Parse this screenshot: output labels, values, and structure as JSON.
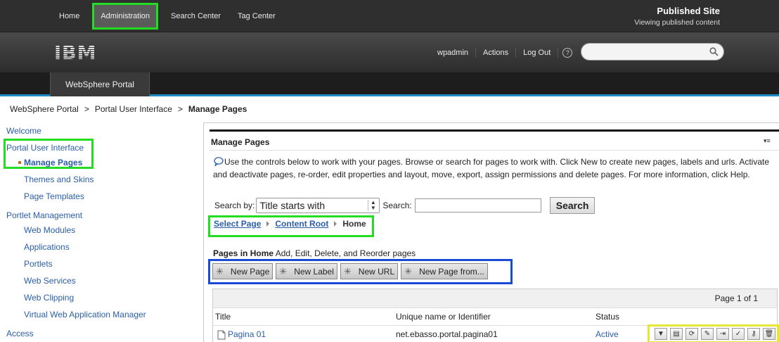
{
  "topnav": {
    "items": [
      "Home",
      "Administration",
      "Search Center",
      "Tag Center"
    ]
  },
  "site": {
    "title": "Published Site",
    "subtitle": "Viewing published content"
  },
  "brand": {
    "logo_text": "IBM"
  },
  "userbar": {
    "user": "wpadmin",
    "actions": "Actions",
    "logout": "Log Out",
    "help": "?"
  },
  "tabs": {
    "main": "WebSphere Portal"
  },
  "breadcrumb": {
    "items": [
      "WebSphere Portal",
      "Portal User Interface",
      "Manage Pages"
    ],
    "separator": ">"
  },
  "leftnav": {
    "welcome": "Welcome",
    "portal_ui": "Portal User Interface",
    "manage_pages": "Manage Pages",
    "themes": "Themes and Skins",
    "templates": "Page Templates",
    "portlet_mgmt": "Portlet Management",
    "web_modules": "Web Modules",
    "applications": "Applications",
    "portlets": "Portlets",
    "web_services": "Web Services",
    "web_clipping": "Web Clipping",
    "vwam": "Virtual Web Application Manager",
    "access": "Access"
  },
  "portlet": {
    "title": "Manage Pages",
    "menu": "▾≡",
    "description": "Use the controls below to work with your pages. Browse or search for pages to work with. Click New to create new pages, labels and urls. Activate and deactivate pages, re-order, edit properties and layout, move, export, assign permissions and delete pages. For more information, click Help.",
    "search_by_label": "Search by:",
    "search_by_value": "Title starts with",
    "search_label": "Search:",
    "search_value": "",
    "search_button": "Search",
    "path": [
      "Select Page",
      "Content Root",
      "Home"
    ],
    "pages_in_label": "Pages in",
    "pages_in_value": "Home",
    "pages_in_hint": "Add, Edit, Delete, and Reorder pages",
    "buttons": [
      "New Page",
      "New Label",
      "New URL",
      "New Page from..."
    ],
    "pagination": "Page 1 of 1",
    "columns": [
      "Title",
      "Unique name or Identifier",
      "Status"
    ],
    "rows": [
      {
        "title": "Pagina 01",
        "identifier": "net.ebasso.portal.pagina01",
        "status": "Active"
      }
    ],
    "row_actions": [
      "move-down",
      "properties",
      "refresh",
      "edit",
      "export",
      "activate",
      "permissions",
      "delete"
    ]
  },
  "colors": {
    "highlight_green": "#22dd22",
    "highlight_blue": "#1a4bd6",
    "highlight_yellow": "#e6e633",
    "link": "#2a5ea8",
    "tab_underline": "#1b8ac6"
  }
}
